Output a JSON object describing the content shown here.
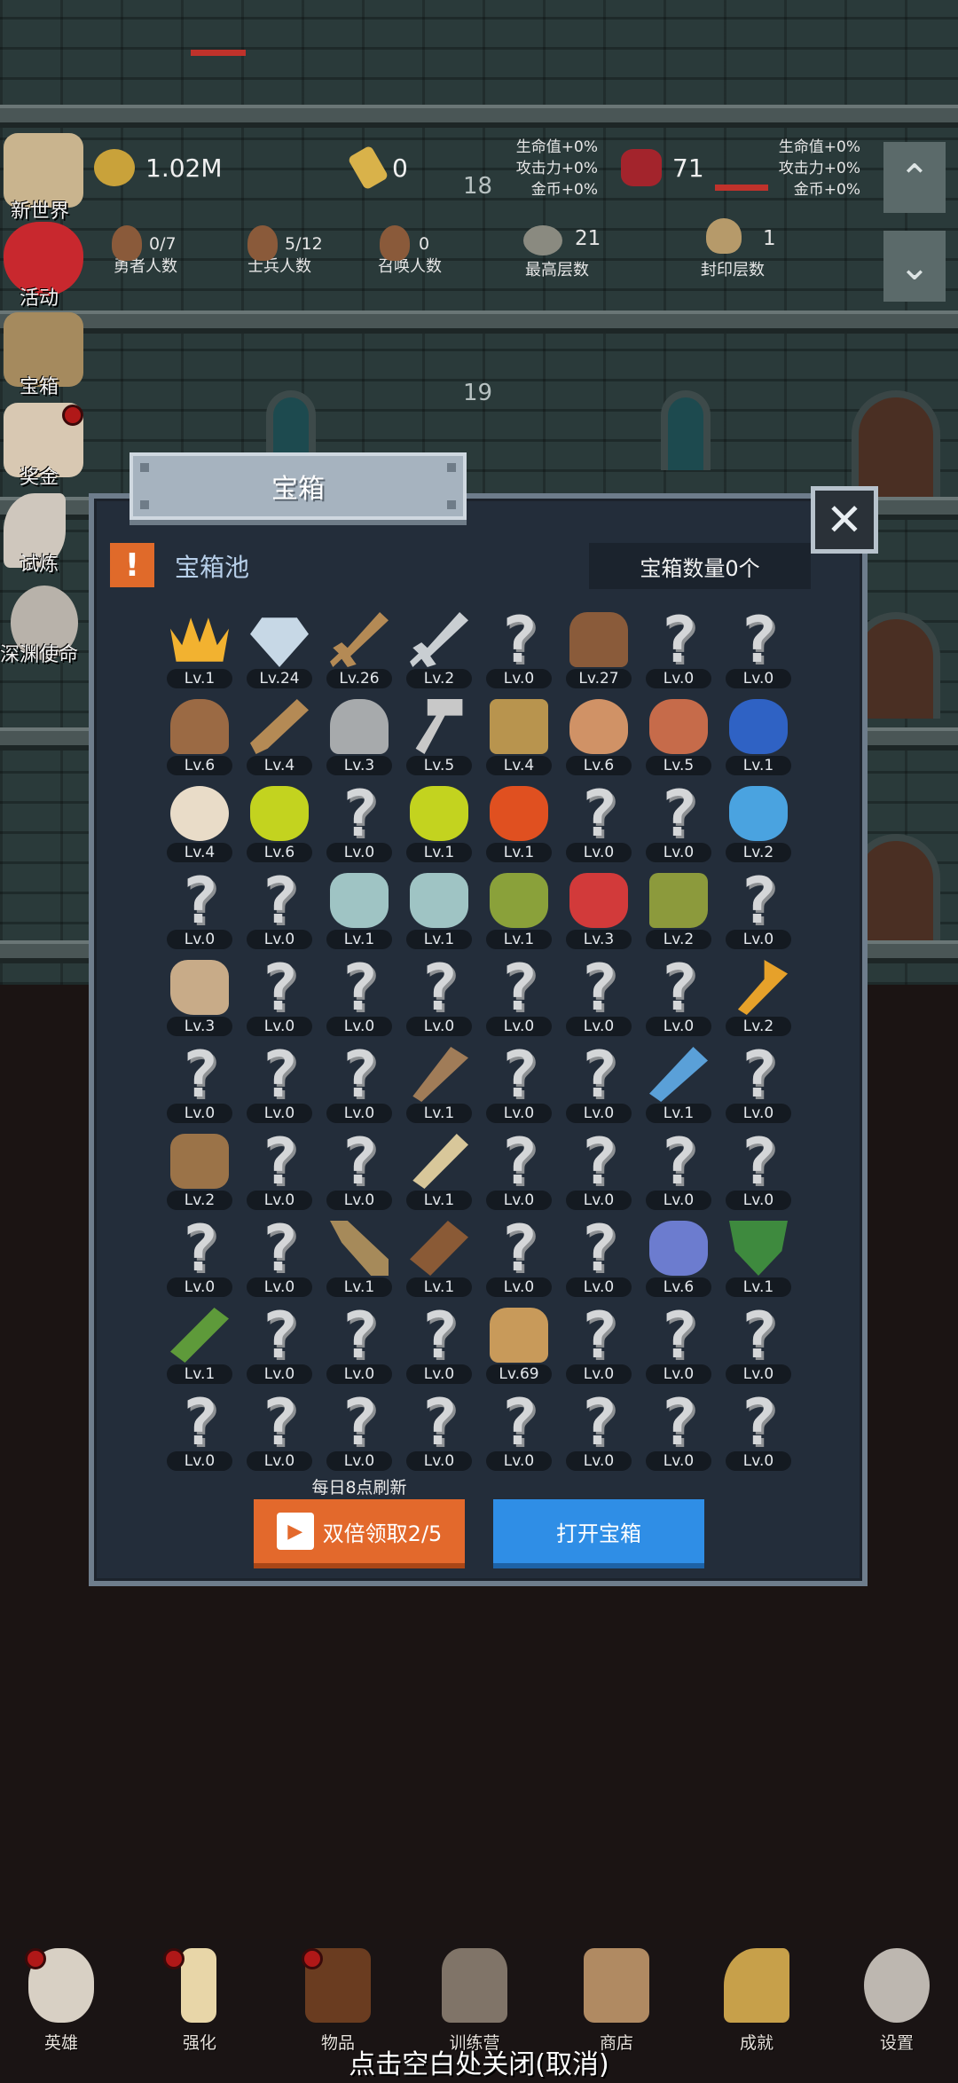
{
  "resources": {
    "gold": "1.02M",
    "bars": "0",
    "gems": "71",
    "buff_left": [
      "生命值+0%",
      "攻击力+0%",
      "金币+0%"
    ],
    "buff_right": [
      "生命值+0%",
      "攻击力+0%",
      "金币+0%"
    ]
  },
  "floors": {
    "upper": "18",
    "lower": "19"
  },
  "counts": {
    "heroes": {
      "value": "0/7",
      "label": "勇者人数"
    },
    "soldiers": {
      "value": "5/12",
      "label": "士兵人数"
    },
    "summons": {
      "value": "0",
      "label": "召唤人数"
    },
    "max_floor": {
      "value": "21",
      "label": "最高层数"
    },
    "sealed_floor": {
      "value": "1",
      "label": "封印层数"
    }
  },
  "side_menu": [
    "新世界",
    "活动",
    "宝箱",
    "奖金",
    "试炼",
    "深渊使命"
  ],
  "modal": {
    "title": "宝箱",
    "close": "✕",
    "badge": "!",
    "pool_title": "宝箱池",
    "chest_count": "宝箱数量0个",
    "refresh_note": "每日8点刷新",
    "double_button": "双倍领取2/5",
    "open_button": "打开宝箱"
  },
  "grid_items": [
    {
      "icon": "crown",
      "lv": "Lv.1"
    },
    {
      "icon": "gem",
      "lv": "Lv.24"
    },
    {
      "icon": "sword",
      "lv": "Lv.26"
    },
    {
      "icon": "sword2",
      "lv": "Lv.2"
    },
    {
      "icon": "unknown",
      "lv": "Lv.0"
    },
    {
      "icon": "armor",
      "lv": "Lv.27"
    },
    {
      "icon": "unknown",
      "lv": "Lv.0"
    },
    {
      "icon": "unknown",
      "lv": "Lv.0"
    },
    {
      "icon": "helm",
      "lv": "Lv.6"
    },
    {
      "icon": "dagger",
      "lv": "Lv.4"
    },
    {
      "icon": "helm2",
      "lv": "Lv.3"
    },
    {
      "icon": "hammer",
      "lv": "Lv.5"
    },
    {
      "icon": "helm3",
      "lv": "Lv.4"
    },
    {
      "icon": "meat",
      "lv": "Lv.6"
    },
    {
      "icon": "steak",
      "lv": "Lv.5"
    },
    {
      "icon": "pouch",
      "lv": "Lv.1"
    },
    {
      "icon": "rice",
      "lv": "Lv.4"
    },
    {
      "icon": "potion-y",
      "lv": "Lv.6"
    },
    {
      "icon": "unknown",
      "lv": "Lv.0"
    },
    {
      "icon": "potion-y",
      "lv": "Lv.1"
    },
    {
      "icon": "potion-r",
      "lv": "Lv.1"
    },
    {
      "icon": "unknown",
      "lv": "Lv.0"
    },
    {
      "icon": "unknown",
      "lv": "Lv.0"
    },
    {
      "icon": "potion-b",
      "lv": "Lv.2"
    },
    {
      "icon": "unknown",
      "lv": "Lv.0"
    },
    {
      "icon": "unknown",
      "lv": "Lv.0"
    },
    {
      "icon": "bottle",
      "lv": "Lv.1"
    },
    {
      "icon": "bottle",
      "lv": "Lv.1"
    },
    {
      "icon": "bottle-g",
      "lv": "Lv.1"
    },
    {
      "icon": "bottle-r",
      "lv": "Lv.3"
    },
    {
      "icon": "boot",
      "lv": "Lv.2"
    },
    {
      "icon": "unknown",
      "lv": "Lv.0"
    },
    {
      "icon": "shoe",
      "lv": "Lv.3"
    },
    {
      "icon": "unknown",
      "lv": "Lv.0"
    },
    {
      "icon": "unknown",
      "lv": "Lv.0"
    },
    {
      "icon": "unknown",
      "lv": "Lv.0"
    },
    {
      "icon": "unknown",
      "lv": "Lv.0"
    },
    {
      "icon": "unknown",
      "lv": "Lv.0"
    },
    {
      "icon": "unknown",
      "lv": "Lv.0"
    },
    {
      "icon": "torch",
      "lv": "Lv.2"
    },
    {
      "icon": "unknown",
      "lv": "Lv.0"
    },
    {
      "icon": "unknown",
      "lv": "Lv.0"
    },
    {
      "icon": "unknown",
      "lv": "Lv.0"
    },
    {
      "icon": "staff",
      "lv": "Lv.1"
    },
    {
      "icon": "unknown",
      "lv": "Lv.0"
    },
    {
      "icon": "unknown",
      "lv": "Lv.0"
    },
    {
      "icon": "wand",
      "lv": "Lv.1"
    },
    {
      "icon": "unknown",
      "lv": "Lv.0"
    },
    {
      "icon": "bag",
      "lv": "Lv.2"
    },
    {
      "icon": "unknown",
      "lv": "Lv.0"
    },
    {
      "icon": "unknown",
      "lv": "Lv.0"
    },
    {
      "icon": "club",
      "lv": "Lv.1"
    },
    {
      "icon": "unknown",
      "lv": "Lv.0"
    },
    {
      "icon": "unknown",
      "lv": "Lv.0"
    },
    {
      "icon": "unknown",
      "lv": "Lv.0"
    },
    {
      "icon": "unknown",
      "lv": "Lv.0"
    },
    {
      "icon": "unknown",
      "lv": "Lv.0"
    },
    {
      "icon": "unknown",
      "lv": "Lv.0"
    },
    {
      "icon": "bow",
      "lv": "Lv.1"
    },
    {
      "icon": "quiver",
      "lv": "Lv.1"
    },
    {
      "icon": "unknown",
      "lv": "Lv.0"
    },
    {
      "icon": "unknown",
      "lv": "Lv.0"
    },
    {
      "icon": "octopus",
      "lv": "Lv.6"
    },
    {
      "icon": "shield",
      "lv": "Lv.1"
    },
    {
      "icon": "scroll",
      "lv": "Lv.1"
    },
    {
      "icon": "unknown",
      "lv": "Lv.0"
    },
    {
      "icon": "unknown",
      "lv": "Lv.0"
    },
    {
      "icon": "unknown",
      "lv": "Lv.0"
    },
    {
      "icon": "beer",
      "lv": "Lv.69"
    },
    {
      "icon": "unknown",
      "lv": "Lv.0"
    },
    {
      "icon": "unknown",
      "lv": "Lv.0"
    },
    {
      "icon": "unknown",
      "lv": "Lv.0"
    },
    {
      "icon": "unknown",
      "lv": "Lv.0"
    },
    {
      "icon": "unknown",
      "lv": "Lv.0"
    },
    {
      "icon": "unknown",
      "lv": "Lv.0"
    },
    {
      "icon": "unknown",
      "lv": "Lv.0"
    },
    {
      "icon": "unknown",
      "lv": "Lv.0"
    },
    {
      "icon": "unknown",
      "lv": "Lv.0"
    },
    {
      "icon": "unknown",
      "lv": "Lv.0"
    },
    {
      "icon": "unknown",
      "lv": "Lv.0"
    }
  ],
  "unknown_glyph": "?",
  "bottom_nav": [
    "英雄",
    "强化",
    "物品",
    "训练营",
    "商店",
    "成就",
    "设置"
  ],
  "close_hint": "点击空白处关闭(取消)",
  "colors": {
    "accent_orange": "#e3692c",
    "accent_blue": "#2f8ee6",
    "panel": "#232d3a"
  }
}
